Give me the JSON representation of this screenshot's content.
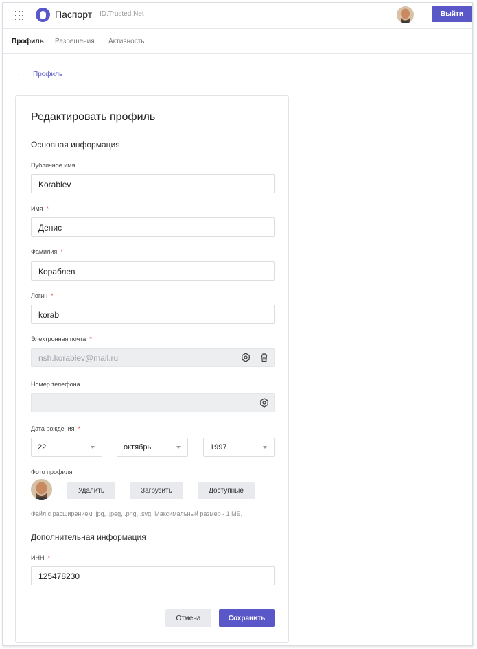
{
  "header": {
    "app_title": "Паспорт",
    "app_subtitle": "ID.Trusted.Net",
    "logout_label": "Выйти",
    "accent_color": "#5a58c9"
  },
  "tabs": [
    {
      "label": "Профиль",
      "active": true
    },
    {
      "label": "Разрешения",
      "active": false
    },
    {
      "label": "Активность",
      "active": false
    }
  ],
  "breadcrumb": {
    "back_label": "Профиль"
  },
  "form": {
    "title": "Редактировать профиль",
    "section_main": "Основная информация",
    "public_name": {
      "label": "Публичное имя",
      "value": "Korablev"
    },
    "first_name": {
      "label": "Имя",
      "value": "Денис"
    },
    "last_name": {
      "label": "Фамилия",
      "value": "Кораблев"
    },
    "login": {
      "label": "Логин",
      "value": "korab"
    },
    "email": {
      "label": "Электронная почта",
      "value": "nsh.korablev@mail.ru"
    },
    "phone": {
      "label": "Номер телефона",
      "value": ""
    },
    "birthdate": {
      "label": "Дата рождения",
      "day": "22",
      "month": "октябрь",
      "year": "1997"
    },
    "photo": {
      "label": "Фото профиля",
      "delete_label": "Удалить",
      "upload_label": "Загрузить",
      "available_label": "Доступные",
      "hint": "Файл с расширением .jpg, .jpeg, .png, .svg. Максимальный размер - 1 МБ."
    },
    "section_extra": "Дополнительная информация",
    "inn": {
      "label": "ИНН",
      "value": "125478230"
    },
    "required_mark": "*",
    "cancel_label": "Отмена",
    "save_label": "Сохранить"
  }
}
